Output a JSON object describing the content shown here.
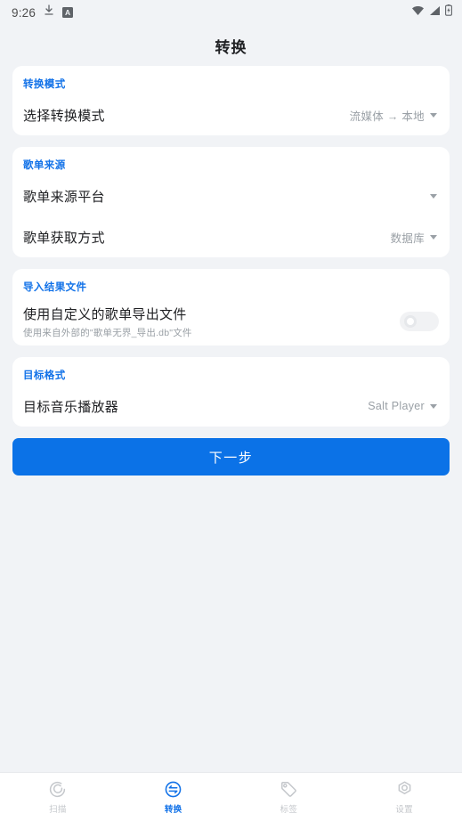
{
  "status_bar": {
    "time": "9:26",
    "left_icons": [
      "download-icon",
      "android-auto-badge"
    ],
    "badge_letter": "A",
    "right_icons": [
      "wifi-icon",
      "cellular-signal-icon",
      "battery-charging-icon"
    ]
  },
  "header": {
    "title": "转换"
  },
  "cards": [
    {
      "id": "conversion-mode",
      "header": "转换模式",
      "rows": [
        {
          "id": "select-conversion-mode",
          "label": "选择转换模式",
          "value": "流媒体 → 本地",
          "control": "dropdown"
        }
      ]
    },
    {
      "id": "playlist-source",
      "header": "歌单来源",
      "rows": [
        {
          "id": "playlist-source-platform",
          "label": "歌单来源平台",
          "value": "",
          "control": "dropdown"
        },
        {
          "id": "playlist-fetch-method",
          "label": "歌单获取方式",
          "value": "数据库",
          "control": "dropdown"
        }
      ]
    },
    {
      "id": "import-result-file",
      "header": "导入结果文件",
      "rows": [
        {
          "id": "use-custom-export-file",
          "label": "使用自定义的歌单导出文件",
          "sub": "使用来自外部的\"歌单无界_导出.db\"文件",
          "control": "toggle",
          "toggle_on": false
        }
      ]
    },
    {
      "id": "target-format",
      "header": "目标格式",
      "rows": [
        {
          "id": "target-music-player",
          "label": "目标音乐播放器",
          "value": "Salt Player",
          "control": "dropdown"
        }
      ]
    }
  ],
  "primary_button": {
    "label": "下一步"
  },
  "bottom_nav": {
    "items": [
      {
        "id": "scan",
        "label": "扫描",
        "icon": "scan-icon",
        "active": false
      },
      {
        "id": "convert",
        "label": "转换",
        "icon": "swap-icon",
        "active": true
      },
      {
        "id": "tag",
        "label": "标签",
        "icon": "tag-icon",
        "active": false
      },
      {
        "id": "settings",
        "label": "设置",
        "icon": "settings-icon",
        "active": false
      }
    ]
  },
  "colors": {
    "accent": "#1272e8",
    "button": "#0b72e7",
    "page_bg": "#f1f3f6",
    "card_bg": "#ffffff",
    "muted_text": "#9aa0a6",
    "inactive_nav": "#c4c7cb"
  }
}
